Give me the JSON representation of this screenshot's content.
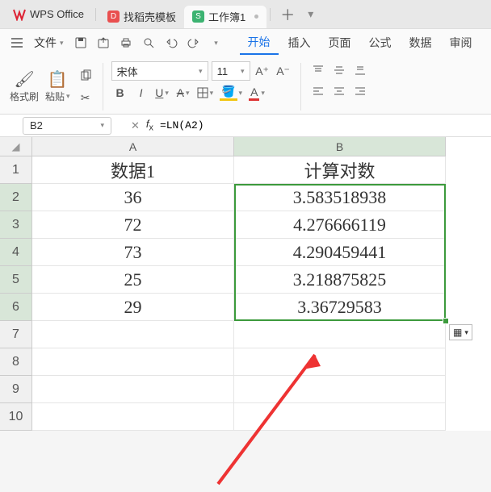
{
  "app_name": "WPS Office",
  "tabs": [
    {
      "icon_bg": "#e94f4f",
      "icon_text": "D",
      "label": "找稻壳模板"
    },
    {
      "icon_bg": "#3cb371",
      "icon_text": "S",
      "label": "工作簿1"
    }
  ],
  "file_menu": "文件",
  "menus": [
    "开始",
    "插入",
    "页面",
    "公式",
    "数据",
    "审阅"
  ],
  "ribbon": {
    "format_painter": "格式刷",
    "paste": "粘贴",
    "font_name": "宋体",
    "font_size": "11"
  },
  "namebox": "B2",
  "formula": "=LN(A2)",
  "columns": [
    "A",
    "B"
  ],
  "rows": [
    {
      "n": 1,
      "A": "数据1",
      "B": "计算对数"
    },
    {
      "n": 2,
      "A": "36",
      "B": "3.583518938"
    },
    {
      "n": 3,
      "A": "72",
      "B": "4.276666119"
    },
    {
      "n": 4,
      "A": "73",
      "B": "4.290459441"
    },
    {
      "n": 5,
      "A": "25",
      "B": "3.218875825"
    },
    {
      "n": 6,
      "A": "29",
      "B": "3.36729583"
    },
    {
      "n": 7,
      "A": "",
      "B": ""
    },
    {
      "n": 8,
      "A": "",
      "B": ""
    },
    {
      "n": 9,
      "A": "",
      "B": ""
    },
    {
      "n": 10,
      "A": "",
      "B": ""
    }
  ],
  "chart_data": {
    "type": "table",
    "title": "计算对数",
    "columns": [
      "数据1",
      "计算对数"
    ],
    "data": [
      {
        "数据1": 36,
        "计算对数": 3.583518938
      },
      {
        "数据1": 72,
        "计算对数": 4.276666119
      },
      {
        "数据1": 73,
        "计算对数": 4.290459441
      },
      {
        "数据1": 25,
        "计算对数": 3.218875825
      },
      {
        "数据1": 29,
        "计算对数": 3.36729583
      }
    ],
    "formula": "=LN(A2)"
  }
}
